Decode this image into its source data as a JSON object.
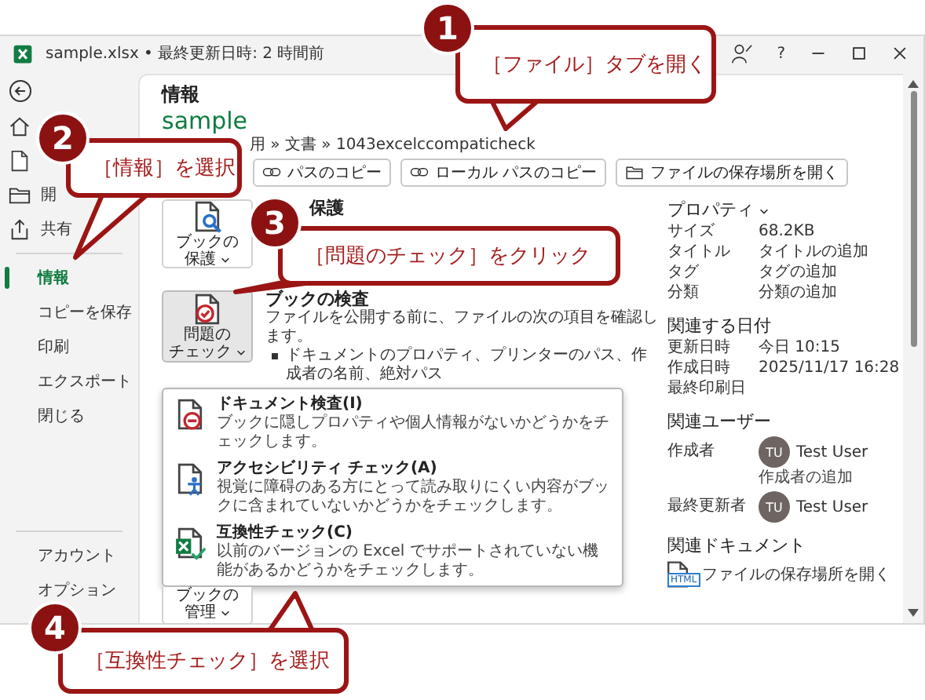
{
  "window": {
    "title": "sample.xlsx • 最終更新日時: 2 時間前"
  },
  "title_controls": [
    {
      "kind": "coauthor"
    },
    {
      "kind": "help",
      "label": "?"
    },
    {
      "kind": "minimize"
    },
    {
      "kind": "maximize"
    },
    {
      "kind": "close"
    }
  ],
  "sidebar": {
    "top_items": [
      {
        "kind": "back"
      },
      {
        "kind": "home"
      },
      {
        "kind": "new"
      },
      {
        "kind": "open",
        "label": "開"
      },
      {
        "kind": "share",
        "label": "共有"
      }
    ],
    "main_items": [
      {
        "label": "情報",
        "selected": true
      },
      {
        "label": "コピーを保存",
        "selected": false
      },
      {
        "label": "印刷",
        "selected": false
      },
      {
        "label": "エクスポート",
        "selected": false
      },
      {
        "label": "閉じる",
        "selected": false
      }
    ],
    "bottom_items": [
      {
        "label": "アカウント"
      },
      {
        "label": "オプション"
      }
    ]
  },
  "info": {
    "heading": "情報",
    "file_name": "sample",
    "path": "用 » 文書 » 1043excelccompaticheck",
    "path_buttons": [
      {
        "kind": "copy",
        "label": "パスのコピー"
      },
      {
        "kind": "copy",
        "label": "ローカル パスのコピー"
      },
      {
        "kind": "folder",
        "label": "ファイルの保存場所を開く"
      }
    ]
  },
  "sections": [
    {
      "kind": "protect",
      "button": [
        "ブックの",
        "保護"
      ],
      "pressed": false,
      "heading": "保護"
    },
    {
      "kind": "inspect",
      "button": [
        "問題の",
        "チェック"
      ],
      "pressed": true,
      "heading": "ブックの検査",
      "description": "ファイルを公開する前に、ファイルの次の項目を確認します。",
      "bullets": [
        "ドキュメントのプロパティ、プリンターのパス、作成者の名前、絶対パス"
      ]
    },
    {
      "kind": "manage",
      "button": [
        "ブックの",
        "管理"
      ],
      "pressed": false
    }
  ],
  "check_menu": {
    "items": [
      {
        "kind": "inspect",
        "title": "ドキュメント検査(I)",
        "description": "ブックに隠しプロパティや個人情報がないかどうかをチェックします。"
      },
      {
        "kind": "accessibility",
        "title": "アクセシビリティ チェック(A)",
        "description": "視覚に障碍のある方にとって読み取りにくい内容がブックに含まれていないかどうかをチェックします。"
      },
      {
        "kind": "compatibility",
        "title": "互換性チェック(C)",
        "description": "以前のバージョンの Excel でサポートされていない機能があるかどうかをチェックします。"
      }
    ]
  },
  "properties": {
    "heading": "プロパティ",
    "rows": [
      {
        "label": "サイズ",
        "value": "68.2KB"
      },
      {
        "label": "タイトル",
        "value": "タイトルの追加"
      },
      {
        "label": "タグ",
        "value": "タグの追加"
      },
      {
        "label": "分類",
        "value": "分類の追加"
      }
    ]
  },
  "related_dates": {
    "heading": "関連する日付",
    "rows": [
      {
        "label": "更新日時",
        "value": "今日 10:15"
      },
      {
        "label": "作成日時",
        "value": "2025/11/17 16:28"
      },
      {
        "label": "最終印刷日"
      }
    ]
  },
  "related_people": {
    "heading": "関連ユーザー",
    "author": {
      "label": "作成者",
      "initials": "TU",
      "name": "Test User"
    },
    "add_author": "作成者の追加",
    "last_modified_by": {
      "label": "最終更新者",
      "initials": "TU",
      "name": "Test User"
    }
  },
  "related_documents": {
    "heading": "関連ドキュメント",
    "items": [
      {
        "badge": "HTML",
        "label": "ファイルの保存場所を開く"
      }
    ]
  },
  "callouts": [
    {
      "number": "1",
      "text": "［ファイル］タブを開く"
    },
    {
      "number": "2",
      "text": "［情報］を選択"
    },
    {
      "number": "3",
      "text": "［問題のチェック］をクリック"
    },
    {
      "number": "4",
      "text": "［互換性チェック］を選択"
    }
  ]
}
